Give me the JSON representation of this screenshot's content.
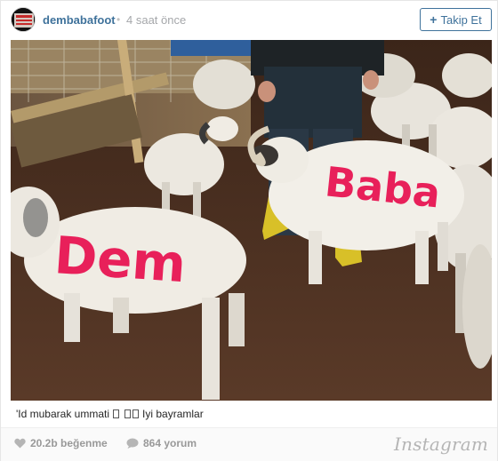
{
  "post": {
    "username": "dembabafoot",
    "separator": "•",
    "time_ago": "4 saat önce",
    "follow_label": "Takip Et",
    "follow_icon": "plus-icon",
    "caption_start": "'Id mubarak ummati",
    "caption_end": "Iyi bayramlar",
    "likes": "20.2b beğenme",
    "comments": "864 yorum",
    "brand": "Instagram"
  },
  "photo": {
    "sheep_left_text": "Dem",
    "sheep_right_text": "Baba"
  },
  "colors": {
    "link": "#3f729b",
    "muted": "#a5a7aa",
    "paint": "#e8205a"
  }
}
